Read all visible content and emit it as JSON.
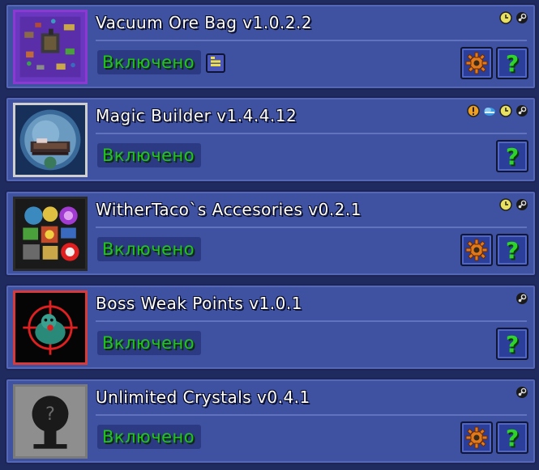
{
  "mods": [
    {
      "title": "Vacuum Ore Bag v1.0.2.2",
      "status": "Включено",
      "tag_icons": [
        "clock-icon",
        "steam-icon"
      ],
      "has_config": true,
      "has_info": true,
      "has_help": true,
      "help_label": "?",
      "thumb_border": "#8a3ad0"
    },
    {
      "title": "Magic Builder v1.4.4.12",
      "status": "Включено",
      "tag_icons": [
        "exclamation-icon",
        "cloud-icon",
        "clock-icon",
        "steam-icon"
      ],
      "has_config": false,
      "has_info": false,
      "has_help": true,
      "help_label": "?",
      "thumb_border": "#cfcfcf"
    },
    {
      "title": "WitherTaco`s Accesories v0.2.1",
      "status": "Включено",
      "tag_icons": [
        "clock-icon",
        "steam-icon"
      ],
      "has_config": true,
      "has_info": false,
      "has_help": true,
      "help_label": "?",
      "thumb_border": "#2a2a2a"
    },
    {
      "title": "Boss Weak Points v1.0.1",
      "status": "Включено",
      "tag_icons": [
        "steam-icon"
      ],
      "has_config": false,
      "has_info": false,
      "has_help": true,
      "help_label": "?",
      "thumb_border": "#d83a3a"
    },
    {
      "title": "Unlimited Crystals v0.4.1",
      "status": "Включено",
      "tag_icons": [
        "steam-icon"
      ],
      "has_config": true,
      "has_info": false,
      "has_help": true,
      "help_label": "?",
      "thumb_border": "#7a7a7a"
    }
  ],
  "colors": {
    "panel": "#3f51a1",
    "enabled_text": "#22c21f",
    "help_glyph": "#2fd42a",
    "gear": "#e07a1a"
  }
}
